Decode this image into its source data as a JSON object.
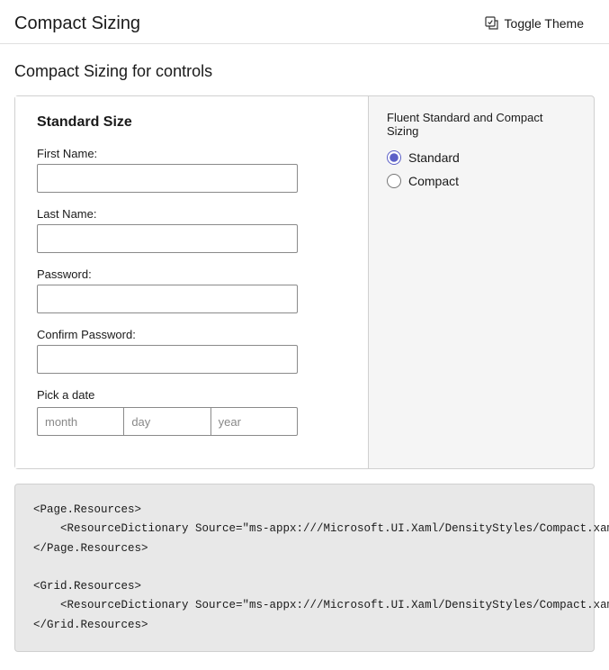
{
  "header": {
    "app_title": "Compact Sizing",
    "toggle_theme_label": "Toggle Theme",
    "toggle_theme_icon": "✎"
  },
  "main": {
    "subtitle": "Compact Sizing for controls",
    "form": {
      "section_title": "Standard Size",
      "fields": [
        {
          "label": "First Name:",
          "placeholder": "",
          "type": "text",
          "id": "first-name"
        },
        {
          "label": "Last Name:",
          "placeholder": "",
          "type": "text",
          "id": "last-name"
        },
        {
          "label": "Password:",
          "placeholder": "",
          "type": "password",
          "id": "password"
        },
        {
          "label": "Confirm Password:",
          "placeholder": "",
          "type": "password",
          "id": "confirm-password"
        }
      ],
      "date_label": "Pick a date",
      "date_placeholders": {
        "month": "month",
        "day": "day",
        "year": "year"
      }
    },
    "settings": {
      "title": "Fluent Standard and Compact Sizing",
      "options": [
        {
          "label": "Standard",
          "value": "standard",
          "checked": true
        },
        {
          "label": "Compact",
          "value": "compact",
          "checked": false
        }
      ]
    },
    "code": {
      "lines": [
        "<Page.Resources>",
        "    <ResourceDictionary Source=\"ms-appx:///Microsoft.UI.Xaml/DensityStyles/Compact.xaml\" />",
        "</Page.Resources>",
        "",
        "<Grid.Resources>",
        "    <ResourceDictionary Source=\"ms-appx:///Microsoft.UI.Xaml/DensityStyles/Compact.xaml\" />",
        "</Grid.Resources>"
      ]
    }
  }
}
